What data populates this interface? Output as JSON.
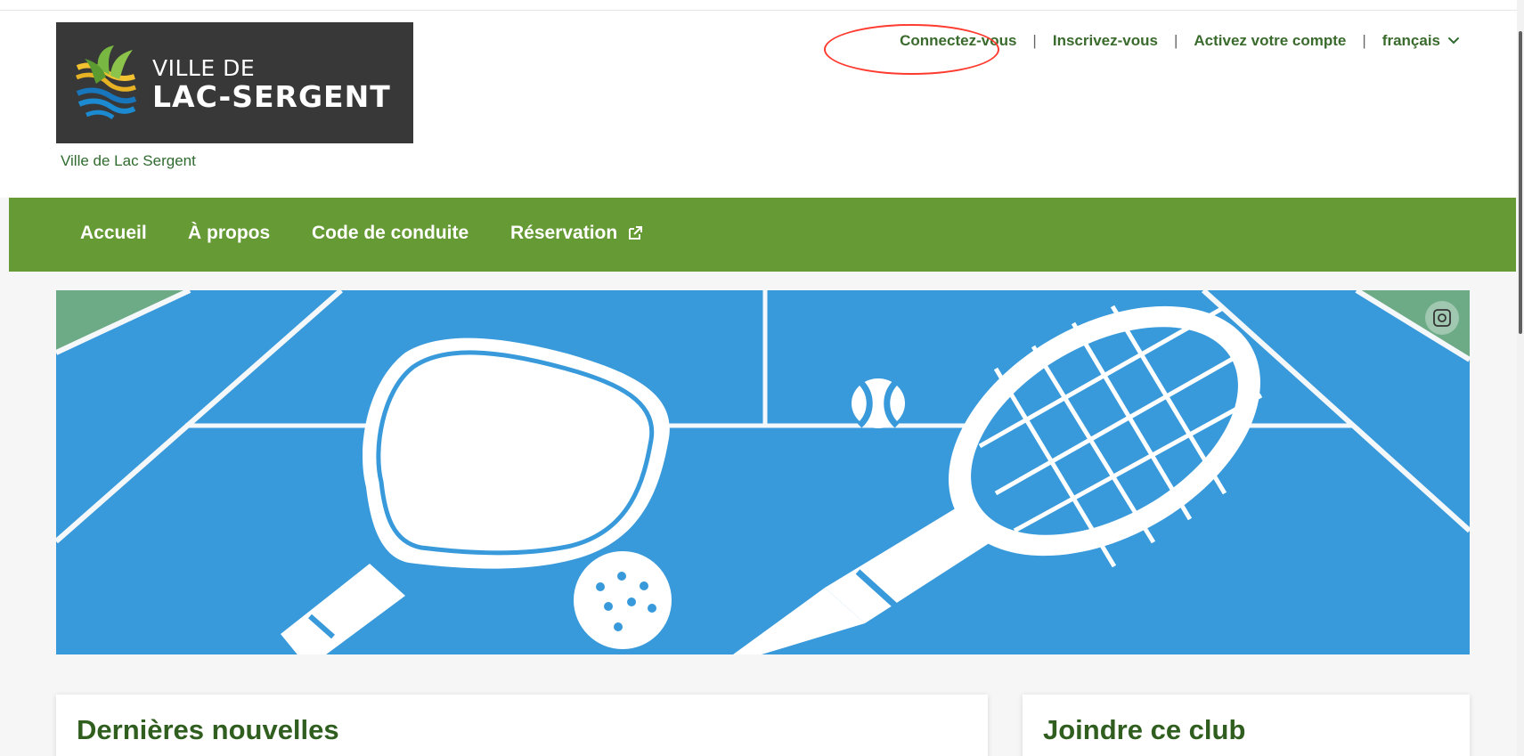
{
  "header": {
    "logo": {
      "line1": "VILLE DE",
      "line2": "LAC-SERGENT"
    },
    "site_name": "Ville de Lac Sergent",
    "top_links": {
      "login": "Connectez-vous",
      "register": "Inscrivez-vous",
      "activate": "Activez votre compte",
      "language": "français"
    },
    "separator": "|"
  },
  "nav": {
    "items": [
      {
        "label": "Accueil"
      },
      {
        "label": "À propos"
      },
      {
        "label": "Code de conduite"
      },
      {
        "label": "Réservation"
      }
    ]
  },
  "hero": {
    "icons": [
      "pickleball-paddle-icon",
      "tennis-racket-icon",
      "tennis-ball-icon",
      "pickleball-icon",
      "camera-icon"
    ]
  },
  "sections": {
    "news_title": "Dernières nouvelles",
    "club_title": "Joindre ce club"
  },
  "colors": {
    "green_nav": "#669a34",
    "court_blue": "#3899db",
    "heading_green": "#2f5e1f",
    "annotation_red": "#ff3b30"
  }
}
